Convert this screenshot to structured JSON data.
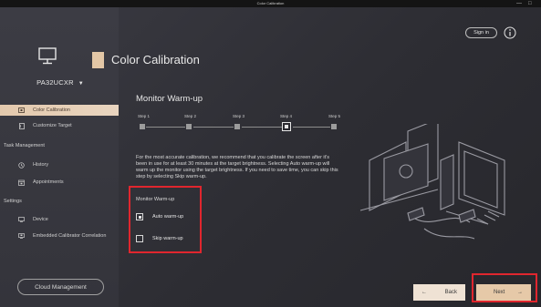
{
  "window": {
    "title": "Color Calibration",
    "controls": [
      "—",
      "□"
    ]
  },
  "header": {
    "sign_in_label": "Sign in"
  },
  "sidebar": {
    "model": "PA32UCXR",
    "items": [
      {
        "label": "Color Calibration",
        "icon": "monitor-calibration-icon",
        "active": true
      },
      {
        "label": "Customize Target",
        "icon": "document-icon",
        "active": false
      }
    ],
    "task_management": {
      "label": "Task Management",
      "items": [
        {
          "label": "History",
          "icon": "history-icon"
        },
        {
          "label": "Appointments",
          "icon": "calendar-icon"
        }
      ]
    },
    "settings": {
      "label": "Settings",
      "items": [
        {
          "label": "Device",
          "icon": "display-icon"
        },
        {
          "label": "Embedded Calibrator Correlation",
          "icon": "calibrator-icon"
        }
      ]
    },
    "cloud_button": "Cloud Management"
  },
  "main": {
    "title": "Color Calibration",
    "step_heading": "Monitor Warm-up",
    "steps": [
      "Step 1",
      "Step 2",
      "Step 3",
      "Step 4",
      "Step 5"
    ],
    "current_step": 4,
    "description": "For the most accurate calibration, we recommend that you calibrate the screen after it's been in use for at least 30 minutes at the target brightness. Selecting Auto warm-up will warm up the monitor using the target brightness. If you need to save time, you can skip this step by selecting Skip warm-up.",
    "warmup_label": "Monitor Warm-up",
    "options": [
      {
        "label": "Auto warm-up",
        "checked": true
      },
      {
        "label": "Skip warm-up",
        "checked": false
      }
    ]
  },
  "footer": {
    "back_label": "Back",
    "next_label": "Next"
  },
  "colors": {
    "accent": "#e3c7a6",
    "highlight": "#e0262e",
    "background": "#2b2a30"
  }
}
